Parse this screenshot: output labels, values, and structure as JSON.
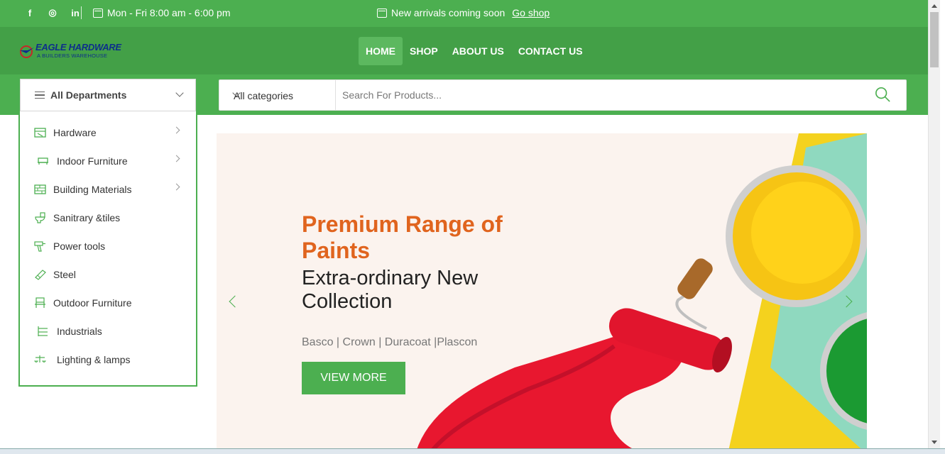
{
  "topbar": {
    "social": [
      "f",
      "◎",
      "in"
    ],
    "hours": "Mon - Fri 8:00 am - 6:00 pm",
    "announcement": "New arrivals coming soon",
    "announcement_link": "Go shop",
    "bg_color": "#4caf50"
  },
  "header": {
    "logo_name": "EAGLE HARDWARE",
    "logo_tagline": "A BUILDERS WAREHOUSE",
    "nav": [
      "HOME",
      "SHOP",
      "ABOUT US",
      "CONTACT US"
    ],
    "active_nav": "HOME"
  },
  "search": {
    "departments_label": "All Departments",
    "category_value": "All categories",
    "placeholder": "Search For Products..."
  },
  "departments": [
    {
      "label": "Hardware",
      "icon": "hardware-icon",
      "has_submenu": true
    },
    {
      "label": "Indoor Furniture",
      "icon": "sofa-icon",
      "has_submenu": true
    },
    {
      "label": "Building Materials",
      "icon": "bricks-icon",
      "has_submenu": true
    },
    {
      "label": "Sanitrary &tiles",
      "icon": "toilet-icon",
      "has_submenu": false
    },
    {
      "label": "Power tools",
      "icon": "drill-icon",
      "has_submenu": false
    },
    {
      "label": "Steel",
      "icon": "steel-icon",
      "has_submenu": false
    },
    {
      "label": "Outdoor Furniture",
      "icon": "bench-icon",
      "has_submenu": false
    },
    {
      "label": "Industrials",
      "icon": "shelf-icon",
      "has_submenu": false
    },
    {
      "label": "Lighting & lamps",
      "icon": "lamp-icon",
      "has_submenu": false
    }
  ],
  "hero": {
    "title": "Premium Range of Paints",
    "subtitle": "Extra-ordinary New Collection",
    "brands": "Basco | Crown | Duracoat |Plascon",
    "button": "VIEW MORE",
    "title_color": "#e0641e",
    "accent_color": "#4caf50"
  }
}
